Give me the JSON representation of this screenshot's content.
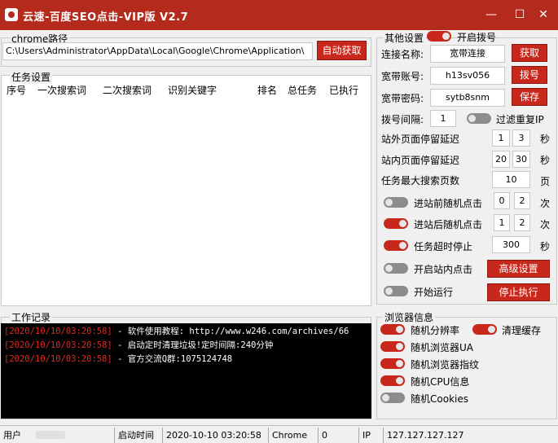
{
  "window": {
    "title": "云速-百度SEO点击-VIP版 V2.7",
    "controls": [
      "—",
      "☐",
      "✕"
    ]
  },
  "chrome_path": {
    "legend": "chrome路径",
    "value": "C:\\Users\\Administrator\\AppData\\Local\\Google\\Chrome\\Application\\",
    "button": "自动获取"
  },
  "tasks": {
    "legend": "任务设置",
    "columns": [
      "序号",
      "一次搜索词",
      "二次搜索词",
      "识别关键字",
      "排名",
      "总任务",
      "已执行"
    ]
  },
  "other_settings": {
    "legend": "其他设置",
    "dial_toggle_label": "开启拨号",
    "dial_toggle_on": true,
    "connection_name_label": "连接名称:",
    "connection_name_value": "宽带连接",
    "get_button": "获取",
    "account_label": "宽带账号:",
    "account_value": "h13sv056",
    "dial_button": "拨号",
    "password_label": "宽带密码:",
    "password_value": "sytb8snm",
    "save_button": "保存",
    "dial_interval_label": "拨号间隔:",
    "dial_interval_value": "1",
    "filter_ip_label": "过滤重复IP",
    "filter_ip_on": false,
    "outside_delay_label": "站外页面停留延迟",
    "outside_delay_min": "1",
    "outside_delay_max": "3",
    "outside_delay_unit": "秒",
    "inside_delay_label": "站内页面停留延迟",
    "inside_delay_min": "20",
    "inside_delay_max": "30",
    "inside_delay_unit": "秒",
    "max_pages_label": "任务最大搜索页数",
    "max_pages_value": "10",
    "max_pages_unit": "页",
    "pre_click_label": "进站前随机点击",
    "pre_click_on": false,
    "pre_click_min": "0",
    "pre_click_max": "2",
    "pre_click_unit": "次",
    "post_click_label": "进站后随机点击",
    "post_click_on": true,
    "post_click_min": "1",
    "post_click_max": "2",
    "post_click_unit": "次",
    "timeout_label": "任务超时停止",
    "timeout_on": true,
    "timeout_value": "300",
    "timeout_unit": "秒",
    "inner_click_label": "开启站内点击",
    "inner_click_on": false,
    "advanced_button": "高级设置",
    "run_label": "开始运行",
    "run_on": false,
    "stop_button": "停止执行"
  },
  "log": {
    "legend": "工作记录",
    "lines": [
      {
        "time": "[2020/10/10/03:20:58]",
        "msg": " - 软件使用教程: http://www.w246.com/archives/66"
      },
      {
        "time": "[2020/10/10/03:20:58]",
        "msg": " - 启动定时清理垃圾!定时间隔:240分钟"
      },
      {
        "time": "[2020/10/10/03:20:58]",
        "msg": " - 官方交流Q群:1075124748"
      }
    ]
  },
  "browser": {
    "legend": "浏览器信息",
    "random_resolution": "随机分辨率",
    "random_resolution_on": true,
    "clear_cache": "清理缓存",
    "clear_cache_on": true,
    "random_ua": "随机浏览器UA",
    "random_ua_on": true,
    "random_fingerprint": "随机浏览器指纹",
    "random_fingerprint_on": true,
    "random_cpu": "随机CPU信息",
    "random_cpu_on": true,
    "random_cookies": "随机Cookies",
    "random_cookies_on": false
  },
  "statusbar": {
    "user_label": "用户",
    "start_time_label": "启动时间",
    "start_time_value": "2020-10-10 03:20:58",
    "browser_value": "Chrome",
    "count_value": "0",
    "ip_label": "IP",
    "ip_value": "127.127.127.127"
  },
  "colors": {
    "titlebar": "#b42a1c",
    "accent_red": "#c8281c",
    "log_time": "#e02b20",
    "log_bg": "#000000"
  }
}
